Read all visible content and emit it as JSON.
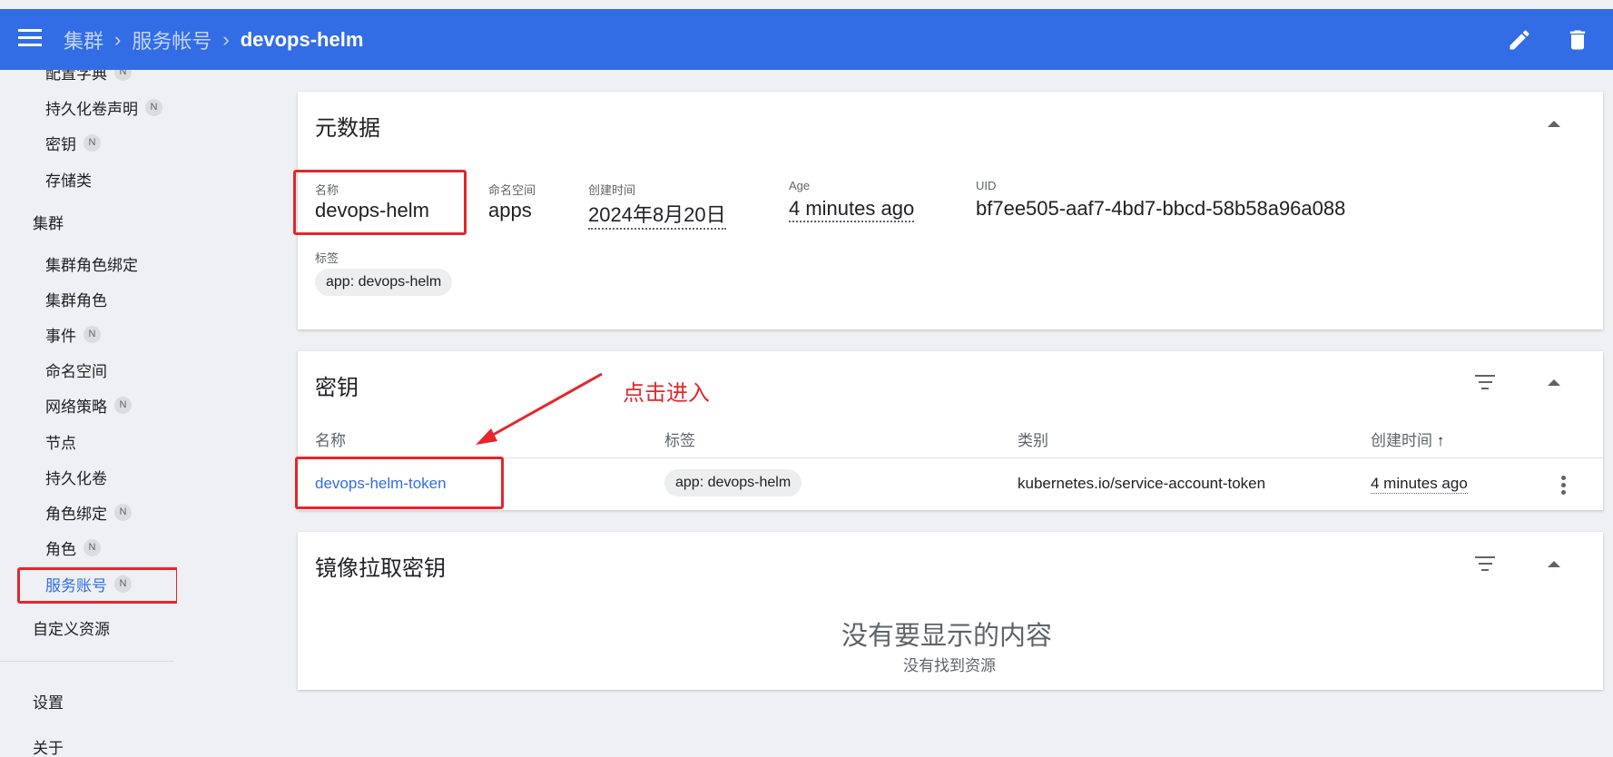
{
  "breadcrumb": {
    "item1": "集群",
    "item2": "服务帐号",
    "current": "devops-helm"
  },
  "header_actions": {
    "edit": "edit-icon",
    "delete": "delete-icon"
  },
  "sidebar": {
    "partial_top": "配置字典",
    "items": [
      {
        "label": "持久化卷声明",
        "badge": "N"
      },
      {
        "label": "密钥",
        "badge": "N"
      },
      {
        "label": "存储类",
        "badge": ""
      }
    ],
    "cluster_header": "集群",
    "cluster_items": [
      {
        "label": "集群角色绑定",
        "badge": ""
      },
      {
        "label": "集群角色",
        "badge": ""
      },
      {
        "label": "事件",
        "badge": "N"
      },
      {
        "label": "命名空间",
        "badge": ""
      },
      {
        "label": "网络策略",
        "badge": "N"
      },
      {
        "label": "节点",
        "badge": ""
      },
      {
        "label": "持久化卷",
        "badge": ""
      },
      {
        "label": "角色绑定",
        "badge": "N"
      },
      {
        "label": "角色",
        "badge": "N"
      },
      {
        "label": "服务账号",
        "badge": "N"
      }
    ],
    "custom_resources": "自定义资源",
    "settings": "设置",
    "about": "关于",
    "active_color": "#326de6"
  },
  "metadata": {
    "title": "元数据",
    "name_label": "名称",
    "name_value": "devops-helm",
    "ns_label": "命名空间",
    "ns_value": "apps",
    "created_label": "创建时间",
    "created_value": "2024年8月20日",
    "age_label": "Age",
    "age_value": "4 minutes ago",
    "uid_label": "UID",
    "uid_value": "bf7ee505-aaf7-4bd7-bbcd-58b58a96a088",
    "labels_label": "标签",
    "label_chip": "app: devops-helm"
  },
  "secrets": {
    "title": "密钥",
    "columns": {
      "name": "名称",
      "labels": "标签",
      "type": "类别",
      "created": "创建时间"
    },
    "sort_arrow": "↑",
    "rows": [
      {
        "name": "devops-helm-token",
        "label": "app: devops-helm",
        "type": "kubernetes.io/service-account-token",
        "created": "4 minutes ago"
      }
    ]
  },
  "annotation": {
    "text": "点击进入",
    "color": "#e5262b"
  },
  "image_pull_secrets": {
    "title": "镜像拉取密钥",
    "empty_title": "没有要显示的内容",
    "empty_sub": "没有找到资源"
  },
  "colors": {
    "primary": "#326de6",
    "background": "#eef0f3",
    "annotation_red": "#e5262b"
  }
}
